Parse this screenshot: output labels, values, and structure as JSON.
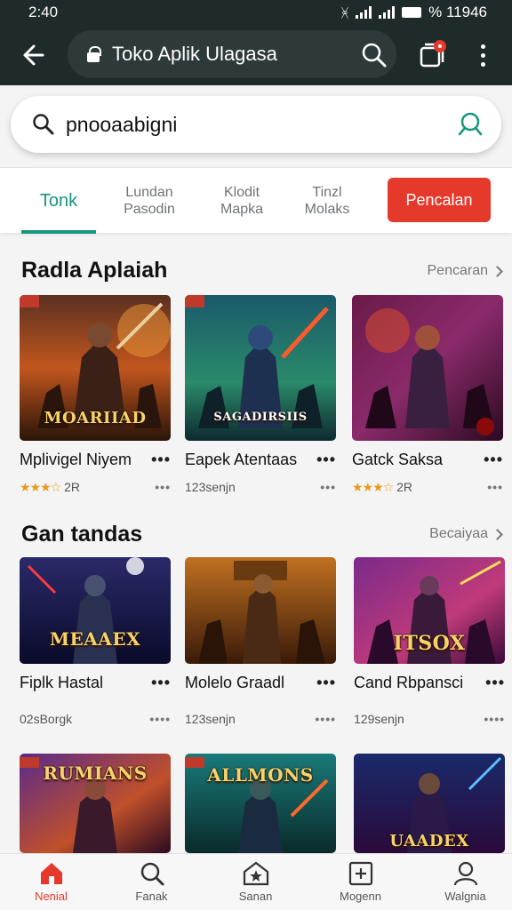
{
  "status_bar": {
    "time": "2:40",
    "right_text": "% 11946"
  },
  "app_bar": {
    "title": "Toko Aplik Ulagasa"
  },
  "search": {
    "value": "pnooaabigni"
  },
  "tabs": [
    {
      "label": "Tonk"
    },
    {
      "label": "Lundan\nPasodin"
    },
    {
      "label": "Klodit\nMapka"
    },
    {
      "label": "Tinzl\nMolaks"
    }
  ],
  "tab_cta": "Pencalan",
  "sections": [
    {
      "title": "Radla Aplaiah",
      "more": "Pencaran",
      "items": [
        {
          "title": "Mplivigel Niyem",
          "meta": "2R",
          "rating": 3.5,
          "logo": "MOARIIAD"
        },
        {
          "title": "Eapek Atentaas",
          "meta": "123senjn",
          "logo": "SAGADIRSIIS"
        },
        {
          "title": "Gatck Saksa",
          "meta": "2R",
          "rating": 3.5,
          "logo": ""
        }
      ]
    },
    {
      "title": "Gan tandas",
      "more": "Becaiyaa",
      "items": [
        {
          "title": "Fiplk Hastal",
          "meta": "02sBorgk",
          "logo": "MEAAEX"
        },
        {
          "title": "Molelo Graadl",
          "meta": "123senjn",
          "logo": ""
        },
        {
          "title": "Cand Rbpansci",
          "meta": "129senjn",
          "logo": "ITSOX"
        }
      ]
    },
    {
      "title": "",
      "more": "",
      "items": [
        {
          "logo": "RUMIANS"
        },
        {
          "logo": "ALLMONS"
        },
        {
          "logo": "UAADEX"
        }
      ]
    }
  ],
  "bottom_nav": [
    {
      "label": "Nenial"
    },
    {
      "label": "Fanak"
    },
    {
      "label": "Sanan"
    },
    {
      "label": "Mogenn"
    },
    {
      "label": "Walgnia"
    }
  ],
  "colors": {
    "accent": "#14967a",
    "cta": "#e4392b",
    "topbar": "#1f2a2a",
    "star": "#e89a1a"
  }
}
